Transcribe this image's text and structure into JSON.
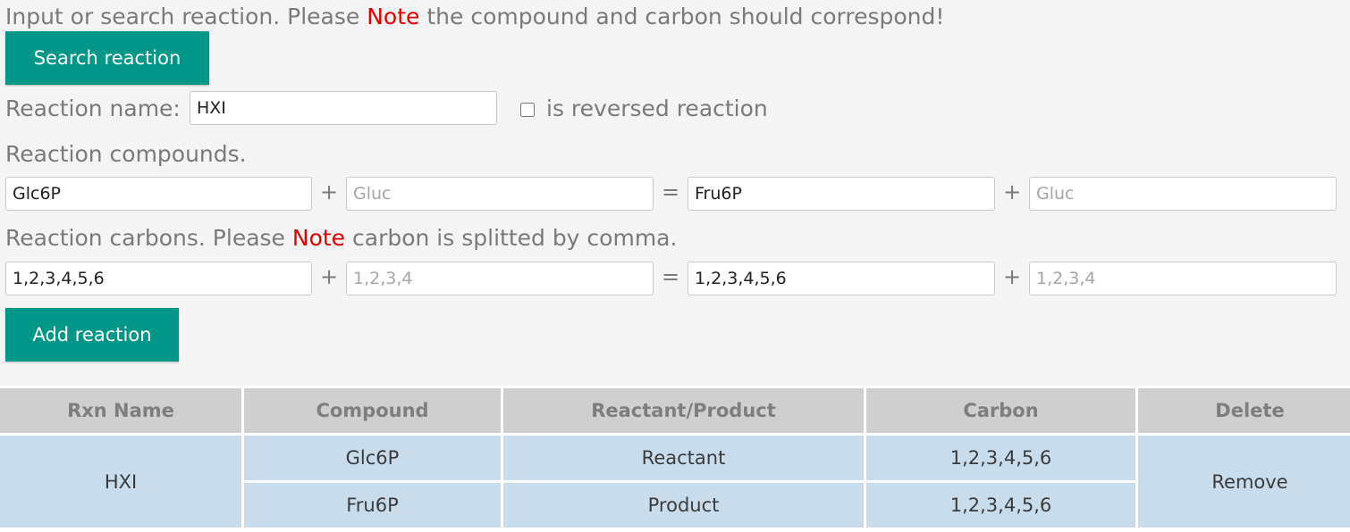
{
  "intro": {
    "before": "Input or search reaction. Please ",
    "note": "Note",
    "after": " the compound and carbon should correspond!"
  },
  "search_button": "Search reaction",
  "reaction_name": {
    "label": "Reaction name:",
    "value": "HXI"
  },
  "reversed": {
    "label": "is reversed reaction",
    "checked": false
  },
  "compounds": {
    "label": "Reaction compounds.",
    "reactant1": {
      "value": "Glc6P",
      "placeholder": ""
    },
    "reactant2": {
      "value": "",
      "placeholder": "Gluc"
    },
    "product1": {
      "value": "Fru6P",
      "placeholder": ""
    },
    "product2": {
      "value": "",
      "placeholder": "Gluc"
    }
  },
  "carbons": {
    "label_before": "Reaction carbons. Please ",
    "label_note": "Note",
    "label_after": " carbon is splitted by comma.",
    "reactant1": {
      "value": "1,2,3,4,5,6",
      "placeholder": ""
    },
    "reactant2": {
      "value": "",
      "placeholder": "1,2,3,4"
    },
    "product1": {
      "value": "1,2,3,4,5,6",
      "placeholder": ""
    },
    "product2": {
      "value": "",
      "placeholder": "1,2,3,4"
    }
  },
  "operators": {
    "plus": "+",
    "equals": "="
  },
  "add_button": "Add reaction",
  "table": {
    "headers": [
      "Rxn Name",
      "Compound",
      "Reactant/Product",
      "Carbon",
      "Delete"
    ],
    "reaction": "HXI",
    "rows": [
      {
        "compound": "Glc6P",
        "role": "Reactant",
        "carbon": "1,2,3,4,5,6"
      },
      {
        "compound": "Fru6P",
        "role": "Product",
        "carbon": "1,2,3,4,5,6"
      }
    ],
    "delete_label": "Remove"
  },
  "colors": {
    "accent": "#009688",
    "note": "#e00000",
    "cell": "#c8dceb",
    "header": "#cfcfcf"
  }
}
